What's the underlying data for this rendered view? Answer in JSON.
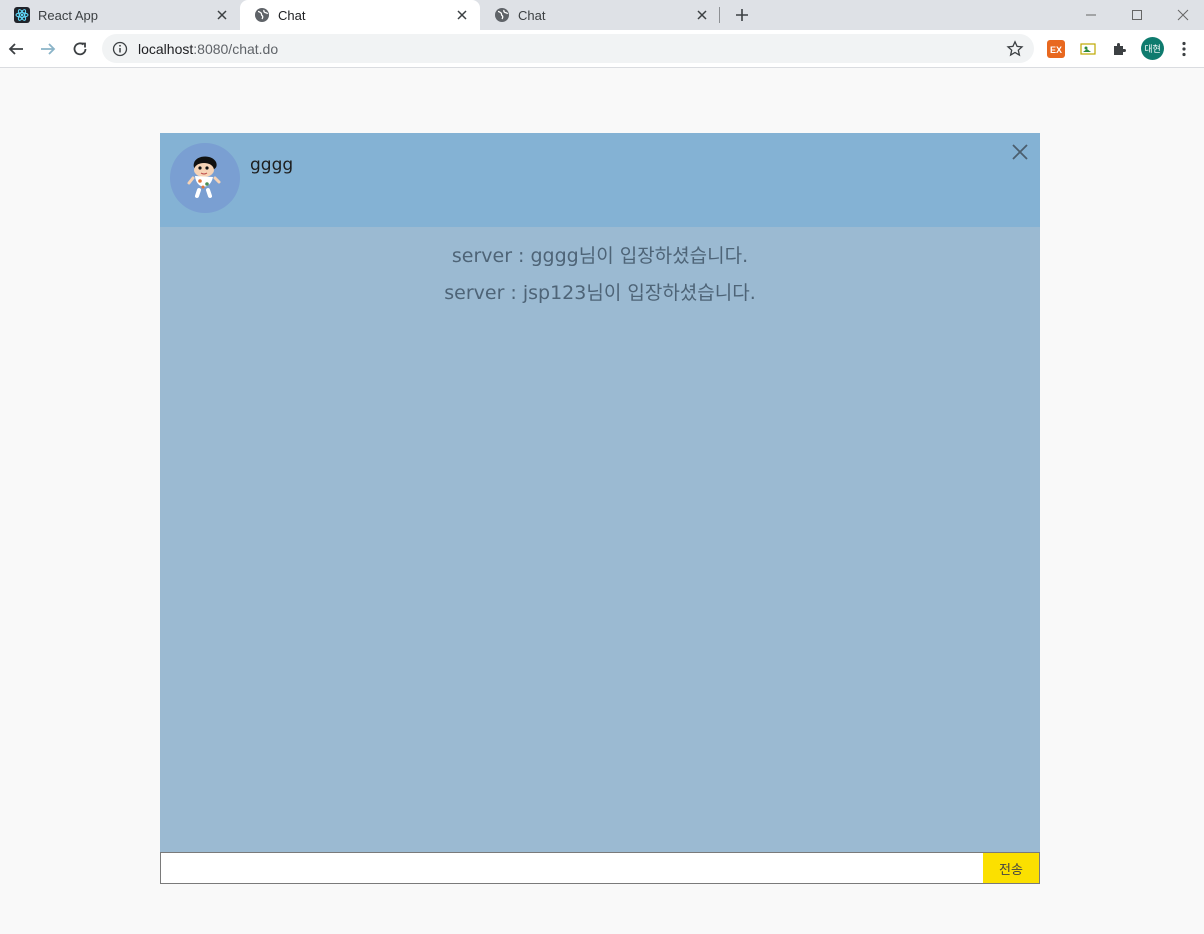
{
  "browser": {
    "tabs": [
      {
        "title": "React App",
        "icon": "react-icon",
        "active": false
      },
      {
        "title": "Chat",
        "icon": "globe-icon",
        "active": true
      },
      {
        "title": "Chat",
        "icon": "globe-icon",
        "active": false
      }
    ],
    "url_host": "localhost",
    "url_path": ":8080/chat.do",
    "profile_initials": "대현"
  },
  "chat": {
    "username": "gggg",
    "messages": [
      "server : gggg님이 입장하셨습니다.",
      "server : jsp123님이 입장하셨습니다."
    ],
    "input_value": "",
    "send_label": "전송"
  },
  "colors": {
    "header_bg": "#84b2d4",
    "chat_bg": "#9bbad2",
    "avatar_bg": "#7a9fd2",
    "send_button": "#fbe000"
  }
}
